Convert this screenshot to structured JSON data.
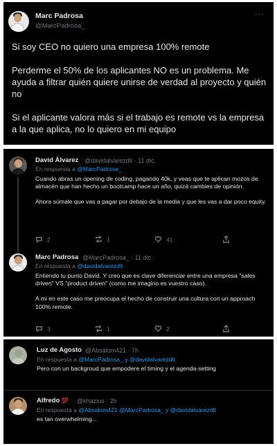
{
  "main_tweet": {
    "name": "Marc Padrosa",
    "handle": "@MarcPadrosa_",
    "more": "···",
    "paragraphs": [
      "Si soy CEO no quiero una empresa 100% remote",
      "Perderme el 50% de los aplicantes NO es un problema. Me ayuda a filtrar quién quiere unirse de verdad al proyecto y quién no",
      "Si el aplicante valora más si el trabajo es remote vs la empresa a la que aplica, no lo quiero en mi equipo"
    ]
  },
  "thread": [
    {
      "name": "David Álvarez",
      "meta": "@davidalvarezdlt · 11 dic.",
      "reply_prefix": "En respuesta a ",
      "reply_mentions": "@MarcPadrosa_",
      "paragraphs": [
        "Cuando abras un opening de coding, pagando 40k, y veas que te aplican mozos de almacén que han hecho un bootcamp hace un año, quizá cambies de opinión.",
        "Ahora súmale que vas a pagar por debajo de la media y que les vas a dar poco equity."
      ],
      "counts": {
        "reply": "2",
        "retweet": "1",
        "like": "41"
      }
    },
    {
      "name": "Marc Padrosa",
      "meta": "@MarcPadrosa_ · 11 dic.",
      "reply_prefix": "En respuesta a ",
      "reply_mentions": "@davidalvarezdlt",
      "paragraphs": [
        "Entiendo tu punto David. Y creo que es clave diferenciar entre una empresa \"sales driven\" VS \"product driven\" (como me imagino es vuestro caso).",
        "A mi en este caso me preocupa el hecho de construir una cultura con un approach 100% remote."
      ],
      "counts": {
        "reply": "3",
        "retweet": "1",
        "like": "2"
      }
    }
  ],
  "replies": [
    {
      "name": "Luz de Agosto",
      "meta": "@Absalom421 · 7h",
      "reply_prefix": "En respuesta a ",
      "reply_mentions": "@MarcPadrosa_ y @davidalvarezdlt",
      "text": "Pero con un backgroud que empodere el timing y el agenda-setting"
    },
    {
      "name": "Alfredo",
      "badge": "💯",
      "meta": "@khazius · 2h",
      "reply_prefix": "En respuesta a ",
      "reply_mentions": "@Absalom421 @MarcPadrosa_ y @davidalvarezdlt",
      "text": "es tan overwhelming..."
    }
  ],
  "colors": {
    "background": "#000000",
    "text": "#e7e9ea",
    "muted": "#71767b",
    "link": "#1d9bf0"
  }
}
